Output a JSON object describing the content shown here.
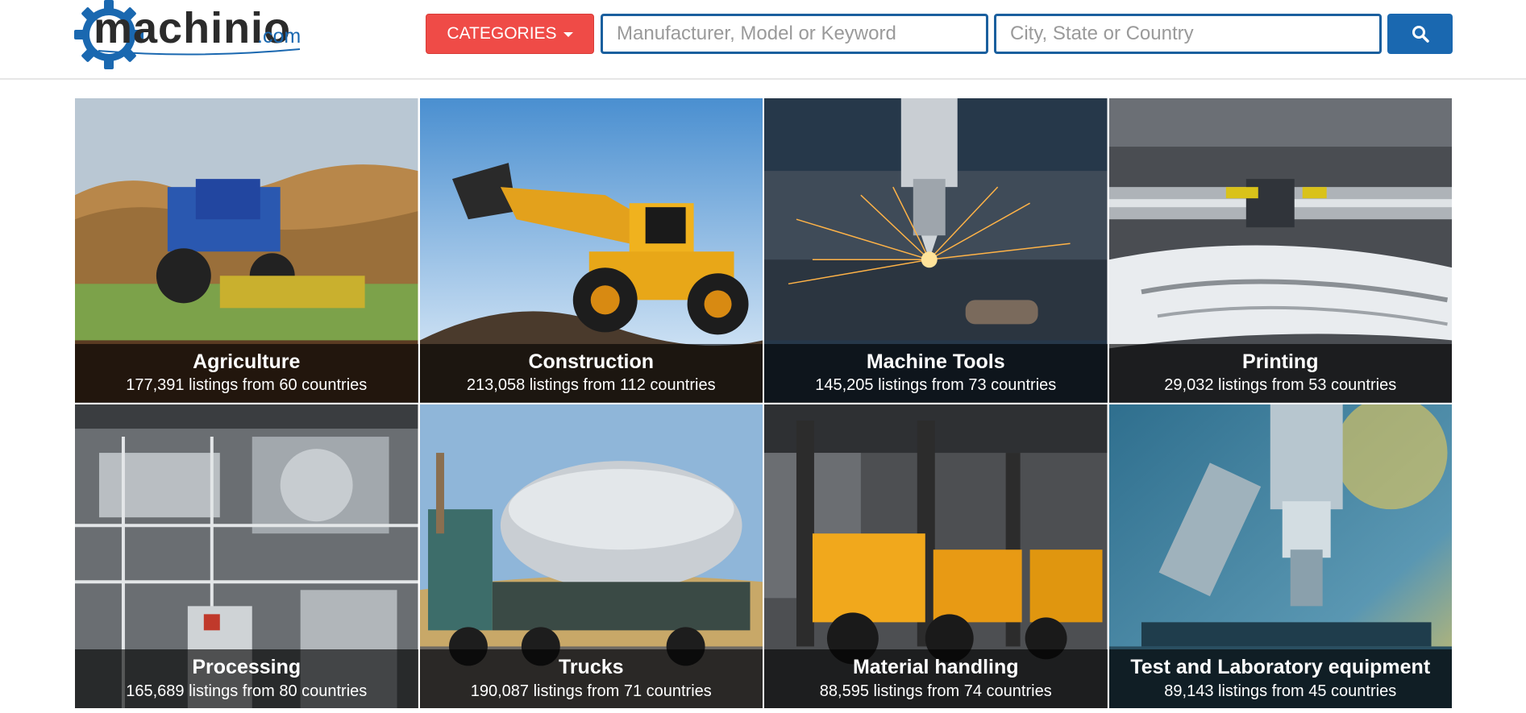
{
  "header": {
    "logo_word": "machinio",
    "logo_tld": ".com",
    "categories_label": "CATEGORIES",
    "keyword_placeholder": "Manufacturer, Model or Keyword",
    "location_placeholder": "City, State or Country"
  },
  "colors": {
    "categories_button": "#ef4b47",
    "search_button": "#1a68b0",
    "input_border": "#1a5f9e"
  },
  "icons": {
    "search": "search-icon",
    "caret": "caret-down-icon",
    "logo": "gear-icon"
  },
  "categories": [
    {
      "title": "Agriculture",
      "subtitle": "177,391 listings from 60 countries"
    },
    {
      "title": "Construction",
      "subtitle": "213,058 listings from 112 countries"
    },
    {
      "title": "Machine Tools",
      "subtitle": "145,205 listings from 73 countries"
    },
    {
      "title": "Printing",
      "subtitle": "29,032 listings from 53 countries"
    },
    {
      "title": "Processing",
      "subtitle": "165,689 listings from 80 countries"
    },
    {
      "title": "Trucks",
      "subtitle": "190,087 listings from 71 countries"
    },
    {
      "title": "Material handling",
      "subtitle": "88,595 listings from 74 countries"
    },
    {
      "title": "Test and Laboratory equipment",
      "subtitle": "89,143 listings from 45 countries"
    }
  ]
}
